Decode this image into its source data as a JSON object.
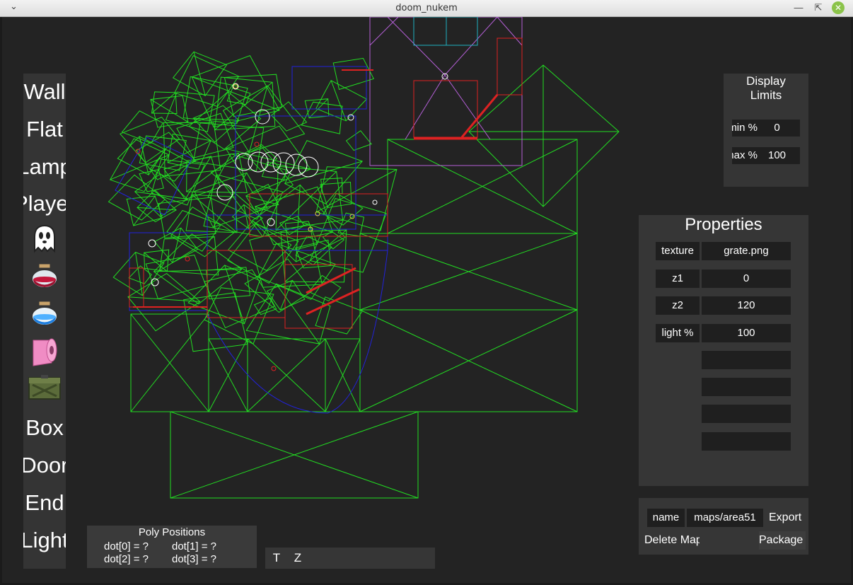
{
  "window": {
    "title": "doom_nukem"
  },
  "sidebar": {
    "tools": [
      {
        "label": "Wall",
        "kind": "text"
      },
      {
        "label": "Flat",
        "kind": "text"
      },
      {
        "label": "Lamp",
        "kind": "text"
      },
      {
        "label": "Player",
        "kind": "text"
      },
      {
        "label": "",
        "kind": "icon",
        "icon": "ghost-icon"
      },
      {
        "label": "",
        "kind": "icon",
        "icon": "red-potion-icon"
      },
      {
        "label": "",
        "kind": "icon",
        "icon": "blue-potion-icon"
      },
      {
        "label": "",
        "kind": "icon",
        "icon": "toilet-paper-icon"
      },
      {
        "label": "",
        "kind": "icon",
        "icon": "ammo-crate-icon"
      },
      {
        "label": "Box",
        "kind": "text"
      },
      {
        "label": "Door",
        "kind": "text"
      },
      {
        "label": "End",
        "kind": "text"
      },
      {
        "label": "Light",
        "kind": "text"
      }
    ]
  },
  "display_limits": {
    "title_line1": "Display",
    "title_line2": "Limits",
    "min_label": "% min",
    "min_value": "0",
    "max_label": "% max",
    "max_value": "100"
  },
  "properties": {
    "title": "Properties",
    "rows": [
      {
        "key": "texture",
        "value": "grate.png"
      },
      {
        "key": "z1",
        "value": "0"
      },
      {
        "key": "z2",
        "value": "120"
      },
      {
        "key": "light %",
        "value": "100"
      }
    ],
    "empty_rows": 4
  },
  "file": {
    "name_label": "name",
    "name_value": "maps/area51",
    "export_label": "Export",
    "delete_label": "Delete Map",
    "package_label": "Package"
  },
  "poly_positions": {
    "title": "Poly Positions",
    "dots": [
      "dot[0] = ?",
      "dot[1] = ?",
      "dot[2] = ?",
      "dot[3] = ?"
    ]
  },
  "toolbar": {
    "t_label": "T",
    "z_label": "Z"
  },
  "colors": {
    "map_green": "#22dd22",
    "map_blue": "#2222dd",
    "map_red": "#dd2222",
    "map_purple": "#b45fd6",
    "map_cyan": "#1fb0c0",
    "close_button": "#8bc34a"
  }
}
